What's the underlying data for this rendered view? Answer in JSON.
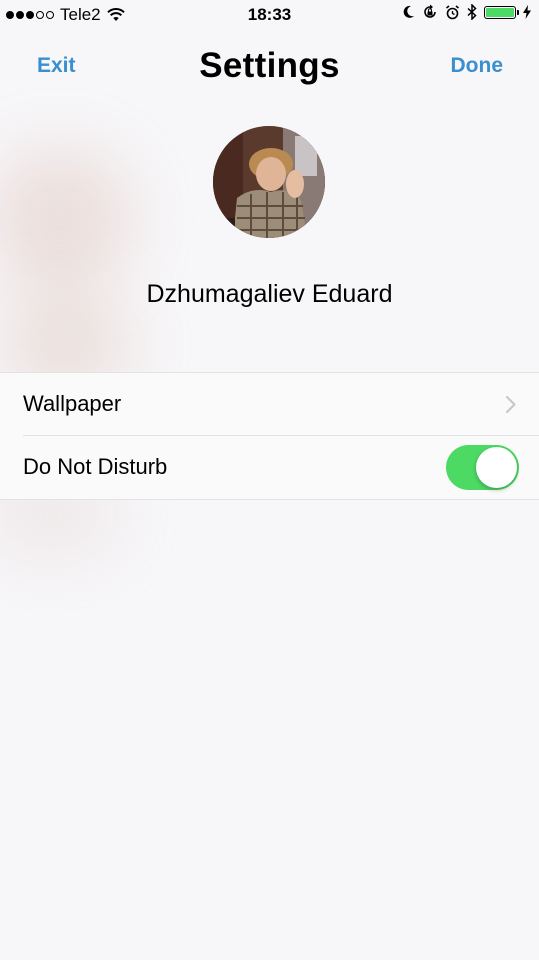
{
  "status_bar": {
    "carrier": "Tele2",
    "time": "18:33",
    "signal_dots_filled": 3,
    "signal_dots_total": 5,
    "icons": [
      "wifi-icon",
      "moon-icon",
      "rotation-lock-icon",
      "alarm-icon",
      "bluetooth-icon",
      "battery-icon",
      "charging-bolt-icon"
    ],
    "battery_level": 1.0
  },
  "nav": {
    "left_label": "Exit",
    "title": "Settings",
    "right_label": "Done"
  },
  "profile": {
    "name": "Dzhumagaliev Eduard"
  },
  "settings": {
    "wallpaper_label": "Wallpaper",
    "dnd_label": "Do Not Disturb",
    "dnd_enabled": true
  },
  "colors": {
    "accent": "#3a8fce",
    "toggle_on": "#4cd964",
    "background": "#f7f6f8"
  }
}
